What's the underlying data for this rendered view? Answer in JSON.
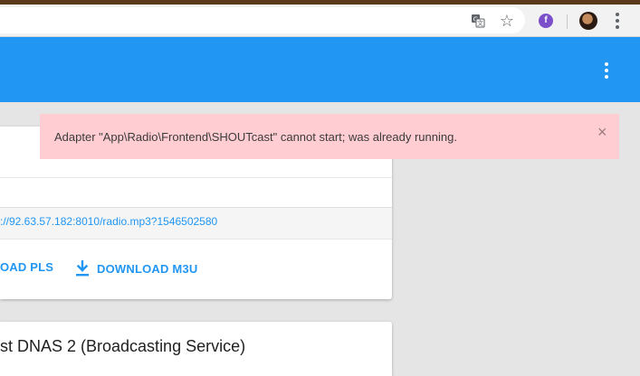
{
  "browser": {
    "icons": [
      "translate-icon",
      "star-icon",
      "extension-icon",
      "profile-avatar",
      "more-vert-icon"
    ],
    "extension_letter": "f"
  },
  "alert": {
    "message": "Adapter \"App\\Radio\\Frontend\\SHOUTcast\" cannot start; was already running.",
    "close_symbol": "×",
    "color": "#ffcdd2"
  },
  "station_card": {
    "stream_url": "://92.63.57.182:8010/radio.mp3?1546502580",
    "download_pls_label": "OAD PLS",
    "download_m3u_label": "DOWNLOAD M3U"
  },
  "second_card": {
    "title": "st DNAS 2 (Broadcasting Service)"
  },
  "colors": {
    "header": "#2196f3",
    "accent": "#2196f3"
  }
}
